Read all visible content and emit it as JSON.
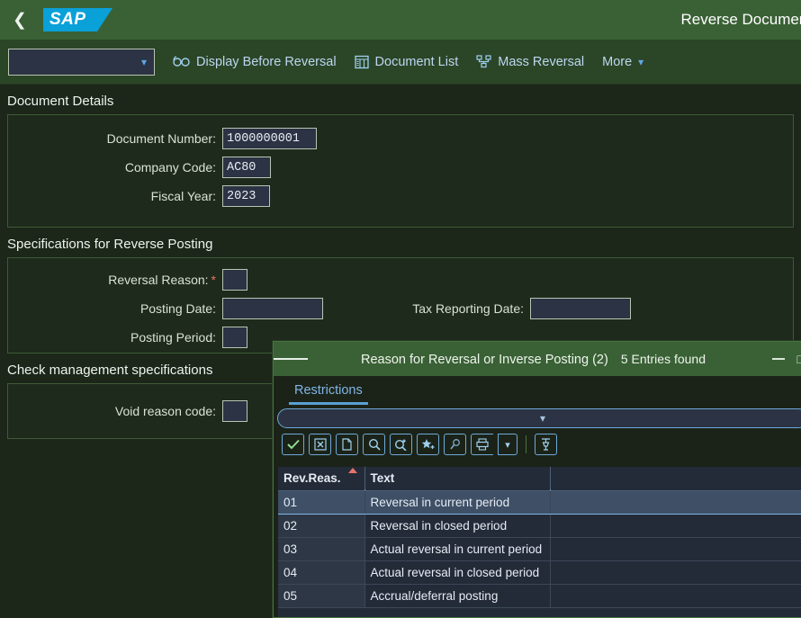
{
  "shell": {
    "back_icon": "chevron-left-icon",
    "logo_text": "SAP",
    "title": "Reverse Document"
  },
  "toolbar": {
    "select_value": "",
    "actions": [
      {
        "label": "Display Before Reversal",
        "icon": "glasses-icon"
      },
      {
        "label": "Document List",
        "icon": "table-list-icon"
      },
      {
        "label": "Mass Reversal",
        "icon": "mass-reversal-icon"
      },
      {
        "label": "More",
        "icon": "chevron-down-icon"
      }
    ]
  },
  "sections": {
    "document_details": {
      "title": "Document Details",
      "fields": [
        {
          "label": "Document Number:",
          "value": "1000000001"
        },
        {
          "label": "Company Code:",
          "value": "AC80"
        },
        {
          "label": "Fiscal Year:",
          "value": "2023"
        }
      ]
    },
    "reverse_posting": {
      "title": "Specifications for Reverse Posting",
      "fields": [
        {
          "label": "Reversal Reason:",
          "value": "",
          "required": true
        },
        {
          "label": "Posting Date:",
          "value": ""
        },
        {
          "label": "Posting Period:",
          "value": ""
        }
      ],
      "right_fields": [
        {
          "label": "Tax Reporting Date:",
          "value": ""
        }
      ]
    },
    "check_management": {
      "title": "Check management specifications",
      "fields": [
        {
          "label": "Void reason code:",
          "value": ""
        }
      ]
    }
  },
  "dialog": {
    "menu_icon": "hamburger-menu-icon",
    "title": "Reason for Reversal or Inverse Posting (2)",
    "entries_found": "5 Entries found",
    "minimize_label": "—",
    "tabs": [
      {
        "label": "Restrictions",
        "active": true
      }
    ],
    "restriction_bar_icon": "chevron-down-icon",
    "tool_buttons": [
      {
        "name": "confirm-icon",
        "glyph": "✔"
      },
      {
        "name": "cancel-icon",
        "glyph": "☒"
      },
      {
        "name": "copy-icon",
        "glyph": "❐"
      },
      {
        "name": "search-icon",
        "glyph": "⌕"
      },
      {
        "name": "search-next-icon",
        "glyph": "⌕"
      },
      {
        "name": "add-favorite-icon",
        "glyph": "★"
      },
      {
        "name": "personalize-icon",
        "glyph": "✐"
      },
      {
        "name": "print-icon",
        "glyph": "⎙"
      },
      {
        "name": "print-dropdown-icon",
        "glyph": "⌄"
      },
      {
        "name": "filter-icon",
        "glyph": "⌷"
      }
    ],
    "table": {
      "columns": [
        "Rev.Reas.",
        "Text"
      ],
      "sort_column": 0,
      "sort_direction": "ascending",
      "rows": [
        {
          "key": "01",
          "text": "Reversal in current period",
          "selected": true
        },
        {
          "key": "02",
          "text": "Reversal in closed period",
          "selected": false
        },
        {
          "key": "03",
          "text": "Actual reversal in current period",
          "selected": false
        },
        {
          "key": "04",
          "text": "Actual reversal in closed period",
          "selected": false
        },
        {
          "key": "05",
          "text": "Accrual/deferral posting",
          "selected": false
        }
      ]
    }
  },
  "colors": {
    "header_green": "#3a6135",
    "toolbar_green": "#2b4527",
    "panel_bg": "#1e2a1b",
    "input_bg": "#2b3344",
    "accent_blue": "#5ea8e8",
    "required_red": "#e8736a",
    "table_bg": "#232b38",
    "row_selected": "#3e4f66"
  }
}
